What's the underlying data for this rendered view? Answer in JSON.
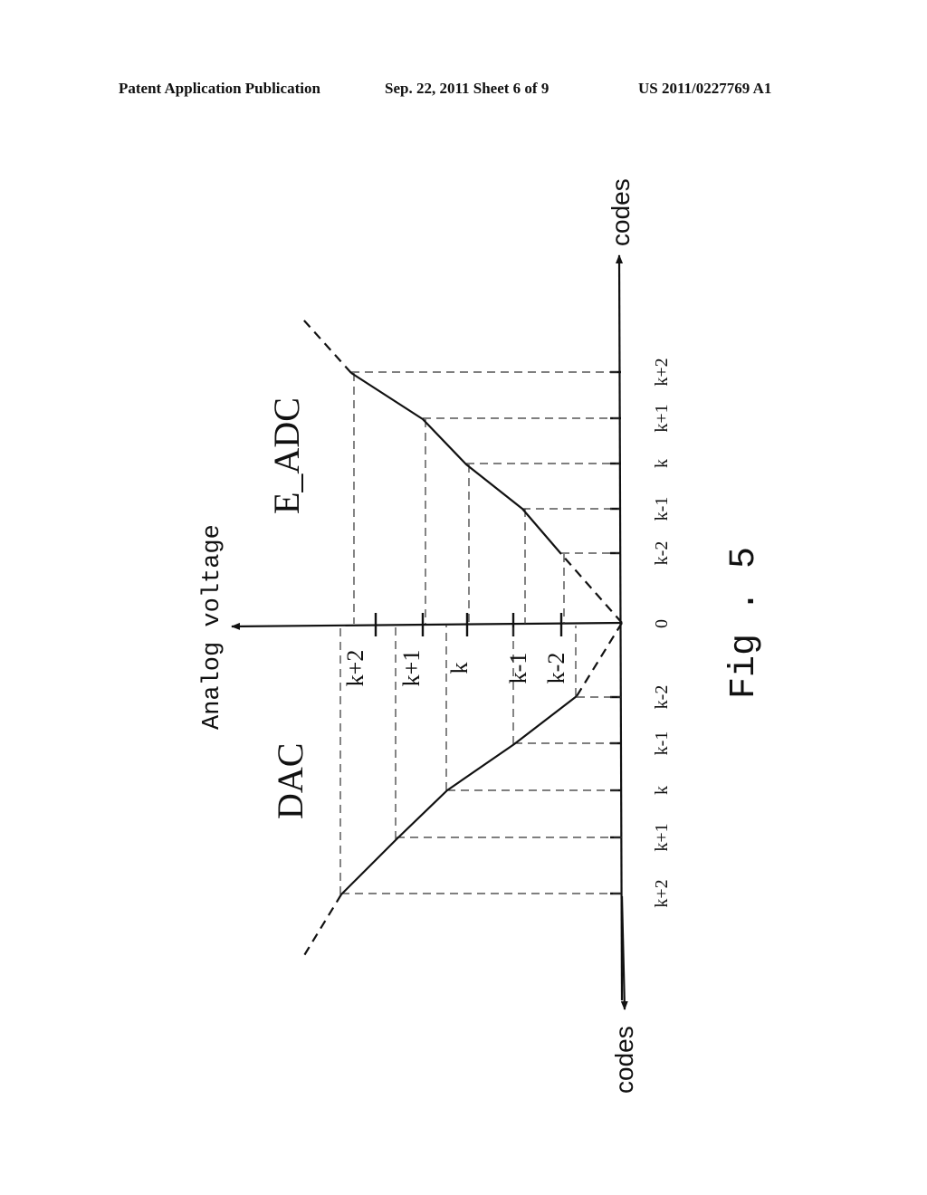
{
  "header": {
    "publication": "Patent Application Publication",
    "date_sheet": "Sep. 22, 2011   Sheet 6 of 9",
    "number": "US 2011/0227769 A1"
  },
  "figure": {
    "caption": "Fig . 5",
    "orientation": "rotated 90° counter-clockwise",
    "voltage_axis_label": "Analog voltage",
    "codes_axis_label_positive": "codes",
    "codes_axis_label_negative": "codes",
    "curve_labels": {
      "adc": "E_ADC",
      "dac": "DAC"
    },
    "origin_label": "0",
    "adc_code_labels": [
      "k-2",
      "k-1",
      "k",
      "k+1",
      "k+2"
    ],
    "dac_code_labels": [
      "k-2",
      "k-1",
      "k",
      "k+1",
      "k+2"
    ],
    "voltage_level_labels": [
      "k-2",
      "k-1",
      "k",
      "k+1",
      "k+2"
    ]
  },
  "chart_data": {
    "type": "line",
    "title": "Fig . 5",
    "xlabel": "codes",
    "ylabel": "Analog voltage",
    "grid": false,
    "code_ticks": [
      "0",
      "k-2",
      "k-1",
      "k",
      "k+1",
      "k+2"
    ],
    "series": [
      {
        "name": "E_ADC",
        "x": [
          0,
          1,
          2,
          3,
          4,
          5
        ],
        "x_labels": [
          "0",
          "k-2",
          "k-1",
          "k",
          "k+1",
          "k+2"
        ],
        "y": [
          0,
          1.5,
          2.5,
          3.6,
          4.4,
          5.9
        ],
        "note": "piecewise-linear transfer curve; dashed extensions before k-2 and beyond k+2"
      },
      {
        "name": "DAC",
        "x": [
          0,
          1,
          2,
          3,
          4,
          5
        ],
        "x_labels": [
          "0",
          "k-2",
          "k-1",
          "k",
          "k+1",
          "k+2"
        ],
        "y": [
          0,
          1.0,
          2.4,
          3.9,
          5.0,
          6.2
        ],
        "note": "mirror side of codes axis; dashed extensions before k-2 and beyond k+2"
      }
    ]
  }
}
